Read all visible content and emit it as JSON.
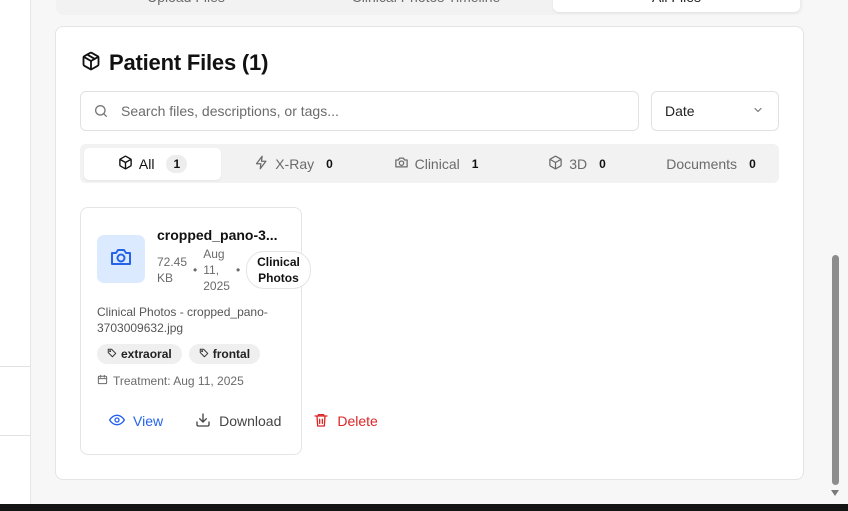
{
  "top_tabs": [
    {
      "label": "Upload Files",
      "active": false
    },
    {
      "label": "Clinical Photos Timeline",
      "active": false
    },
    {
      "label": "All Files",
      "active": true
    }
  ],
  "panel": {
    "title": "Patient Files (1)",
    "search_placeholder": "Search files, descriptions, or tags...",
    "sort_value": "Date"
  },
  "filters": [
    {
      "label": "All",
      "count": "1",
      "icon": "box-icon",
      "active": true
    },
    {
      "label": "X-Ray",
      "count": "0",
      "icon": "zap-icon",
      "active": false
    },
    {
      "label": "Clinical",
      "count": "1",
      "icon": "camera-icon",
      "active": false
    },
    {
      "label": "3D",
      "count": "0",
      "icon": "box-icon",
      "active": false
    },
    {
      "label": "Documents",
      "count": "0",
      "icon": "",
      "active": false
    }
  ],
  "file": {
    "name": "cropped_pano-3...",
    "size_line1": "72.45",
    "size_line2": "KB",
    "date_line1": "Aug",
    "date_line2": "11,",
    "date_line3": "2025",
    "category_line1": "Clinical",
    "category_line2": "Photos",
    "description": "Clinical Photos - cropped_pano-3703009632.jpg",
    "tags": [
      "extraoral",
      "frontal"
    ],
    "treatment": "Treatment: Aug 11, 2025",
    "actions": {
      "view": "View",
      "download": "Download",
      "delete": "Delete"
    }
  },
  "colors": {
    "accent_blue": "#2563eb",
    "danger_red": "#dc2626",
    "thumb_bg": "#dbeafe"
  }
}
